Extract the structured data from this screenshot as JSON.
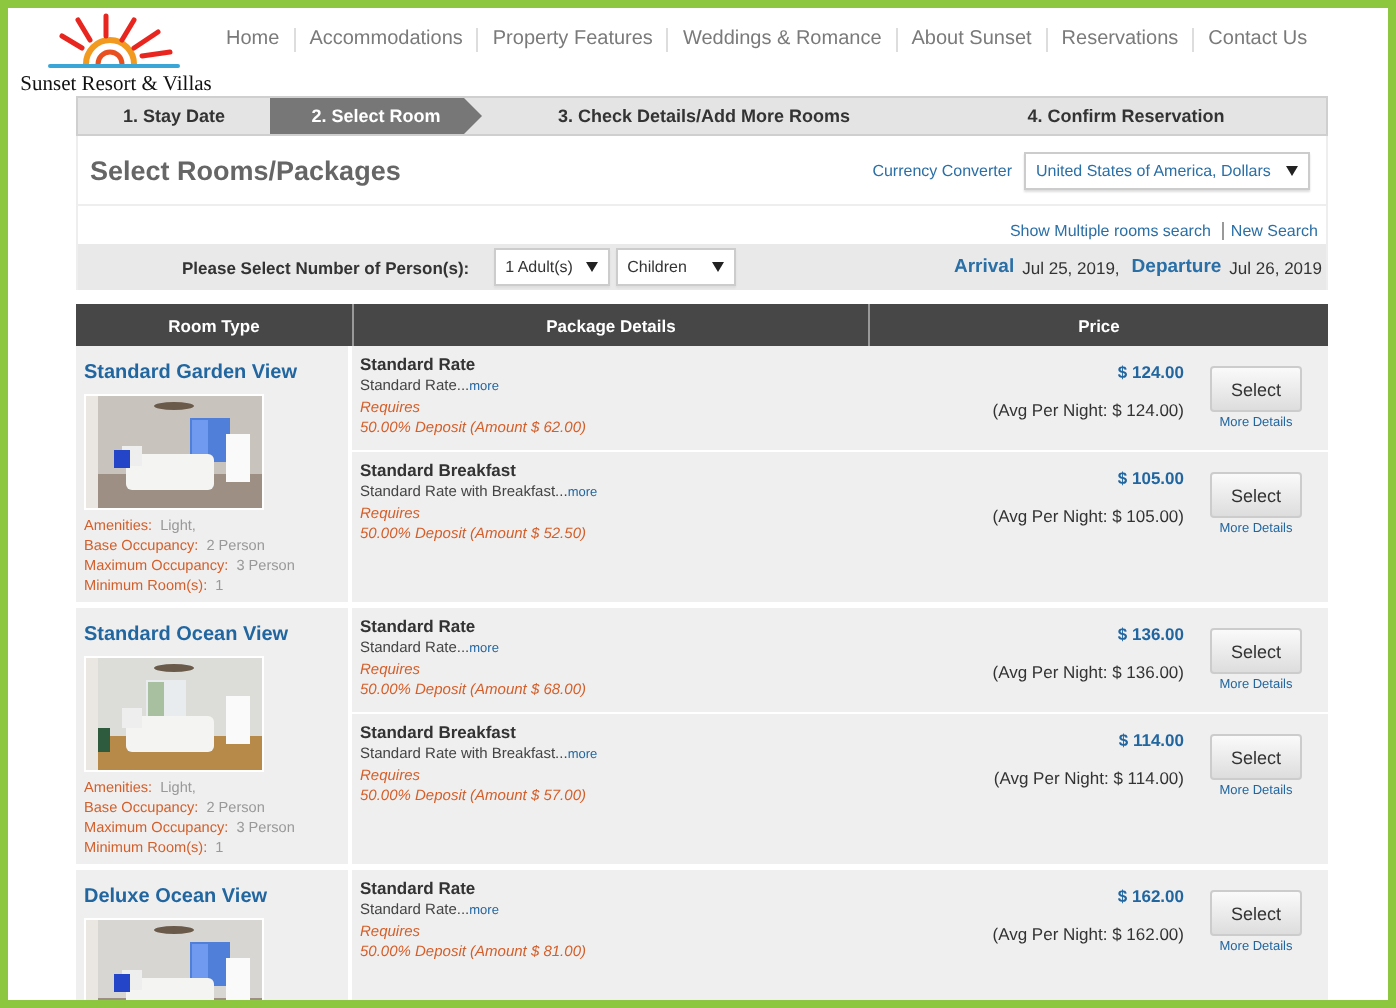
{
  "logo": {
    "text": "Sunset Resort & Villas"
  },
  "nav": [
    "Home",
    "Accommodations",
    "Property Features",
    "Weddings & Romance",
    "About Sunset",
    "Reservations",
    "Contact Us"
  ],
  "steps": [
    {
      "label": "1. Stay Date",
      "selected": false
    },
    {
      "label": "2. Select Room",
      "selected": true
    },
    {
      "label": "3. Check Details/Add More Rooms",
      "selected": false
    },
    {
      "label": "4. Confirm Reservation",
      "selected": false
    }
  ],
  "page_title": "Select Rooms/Packages",
  "currency": {
    "label": "Currency Converter",
    "value": "United States of America, Dollars"
  },
  "links": [
    "Show Multiple rooms search",
    "New Search"
  ],
  "persons": {
    "label": "Please Select Number of Person(s):",
    "adults": "1 Adult(s)",
    "children": "Children",
    "arrival_label": "Arrival",
    "arrival": "Jul 25, 2019,",
    "departure_label": "Departure",
    "departure": "Jul 26, 2019"
  },
  "table": {
    "columns": [
      "Room Type",
      "Package Details",
      "Price"
    ],
    "rooms": [
      {
        "name": "Standard Garden View",
        "picture": {
          "kind": "picture"
        },
        "details": [
          {
            "label": "Amenities:",
            "value": "Light,"
          },
          {
            "label": "Base Occupancy:",
            "value": "2 Person"
          },
          {
            "label": "Maximum Occupancy:",
            "value": "3 Person"
          },
          {
            "label": "Minimum Room(s):",
            "value": "1"
          }
        ],
        "packages": [
          {
            "name": "Standard Rate",
            "description": "Standard Rate...",
            "more": "more",
            "requires": "Requires",
            "deposit": "50.00% Deposit (Amount $ 62.00)",
            "price": "$ 124.00",
            "avg": "(Avg Per Night: $ 124.00)",
            "button": "Select",
            "details_link": "More Details"
          },
          {
            "name": "Standard Breakfast",
            "description": "Standard Rate with Breakfast...",
            "more": "more",
            "requires": "Requires",
            "deposit": "50.00% Deposit (Amount $ 52.50)",
            "price": "$ 105.00",
            "avg": "(Avg Per Night: $ 105.00)",
            "button": "Select",
            "details_link": "More Details"
          }
        ]
      },
      {
        "name": "Standard Ocean View",
        "picture": {
          "kind": "picture"
        },
        "details": [
          {
            "label": "Amenities:",
            "value": "Light,"
          },
          {
            "label": "Base Occupancy:",
            "value": "2 Person"
          },
          {
            "label": "Maximum Occupancy:",
            "value": "3 Person"
          },
          {
            "label": "Minimum Room(s):",
            "value": "1"
          }
        ],
        "packages": [
          {
            "name": "Standard Rate",
            "description": "Standard Rate...",
            "more": "more",
            "requires": "Requires",
            "deposit": "50.00% Deposit (Amount $ 68.00)",
            "price": "$ 136.00",
            "avg": "(Avg Per Night: $ 136.00)",
            "button": "Select",
            "details_link": "More Details"
          },
          {
            "name": "Standard Breakfast",
            "description": "Standard Rate with Breakfast...",
            "more": "more",
            "requires": "Requires",
            "deposit": "50.00% Deposit (Amount $ 57.00)",
            "price": "$ 114.00",
            "avg": "(Avg Per Night: $ 114.00)",
            "button": "Select",
            "details_link": "More Details"
          }
        ]
      },
      {
        "name": "Deluxe Ocean View",
        "picture": {
          "kind": "picture"
        },
        "packages": [
          {
            "name": "Standard Rate",
            "description": "Standard Rate...",
            "more": "more",
            "requires": "Requires",
            "deposit": "50.00% Deposit (Amount $ 81.00)",
            "price": "$ 162.00",
            "avg": "(Avg Per Night: $ 162.00)",
            "button": "Select",
            "details_link": "More Details"
          }
        ]
      }
    ]
  }
}
